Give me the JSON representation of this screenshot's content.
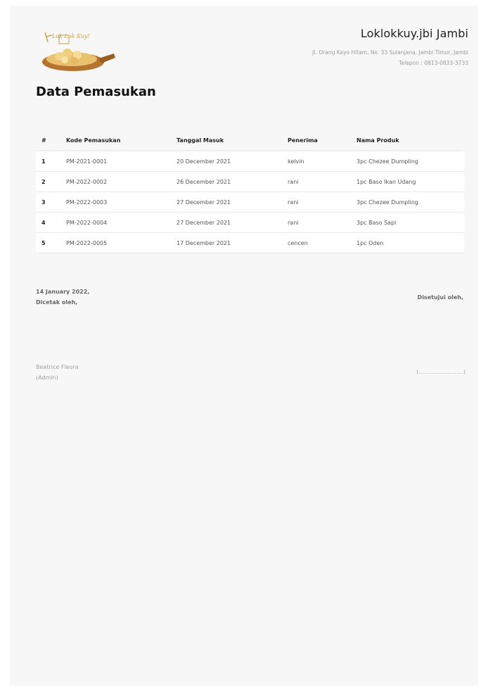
{
  "header": {
    "logo_text": "Lok Lok Kuy!",
    "company_name": "Loklokkuy.jbi Jambi",
    "address": "Jl. Orang Kayo Hitam, No. 33 Sulanjana, Jambi Timur, Jambi",
    "phone": "Telepon : 0813-0833-3733"
  },
  "title": "Data Pemasukan",
  "table": {
    "headers": [
      "#",
      "Kode Pemasukan",
      "Tanggal Masuk",
      "Penerima",
      "Nama Produk"
    ],
    "rows": [
      [
        "1",
        "PM-2021-0001",
        "20 December 2021",
        "kelvin",
        "3pc Chezee Dumpling"
      ],
      [
        "2",
        "PM-2022-0002",
        "26 December 2021",
        "rani",
        "1pc Baso Ikan Udang"
      ],
      [
        "3",
        "PM-2022-0003",
        "27 December 2021",
        "rani",
        "3pc Chezee Dumpling"
      ],
      [
        "4",
        "PM-2022-0004",
        "27 December 2021",
        "rani",
        "3pc Baso Sapi"
      ],
      [
        "5",
        "PM-2022-0005",
        "17 December 2021",
        "cencen",
        "1pc Oden"
      ]
    ]
  },
  "footer": {
    "printed_date": "14 January 2022,",
    "printed_by": "Dicetak oleh,",
    "approved_by": "Disetujui oleh,",
    "signer_name": "Beatrice Fleora",
    "signer_role": "(Admin)",
    "approval_placeholder": "(.........................)"
  }
}
